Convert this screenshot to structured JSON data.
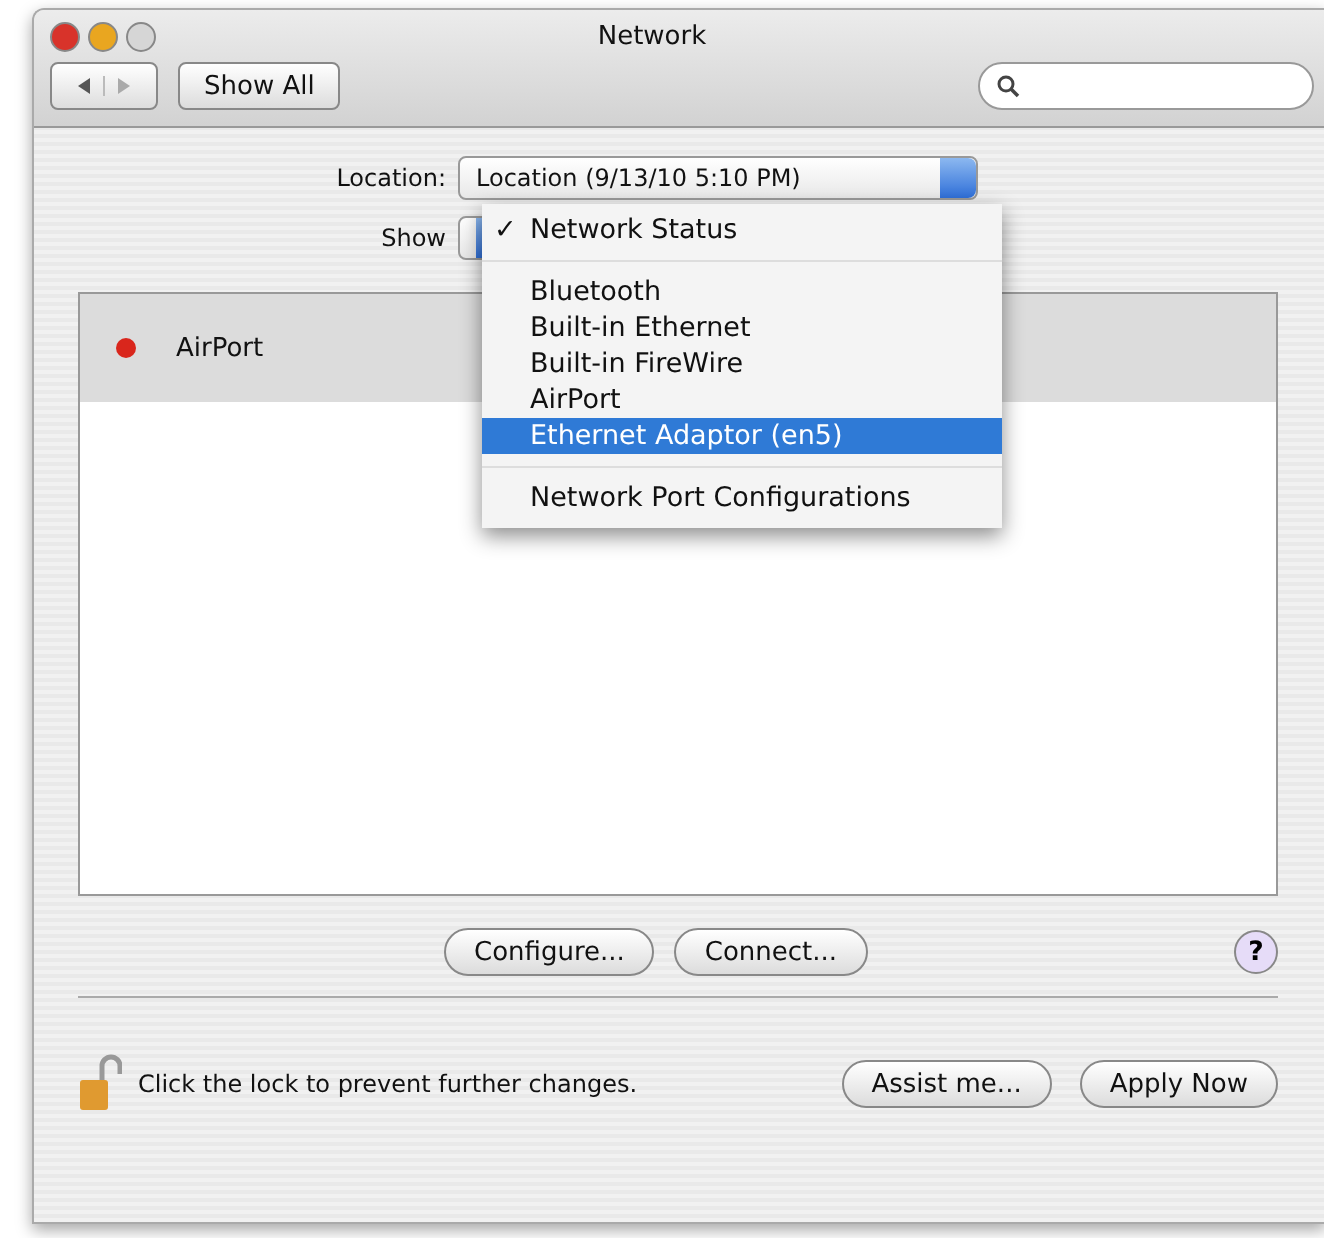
{
  "window": {
    "title": "Network"
  },
  "toolbar": {
    "show_all": "Show All"
  },
  "location": {
    "label": "Location:",
    "value": "Location (9/13/10 5:10 PM)"
  },
  "show": {
    "label": "Show"
  },
  "check_mark": "✓",
  "menu": [
    {
      "kind": "item",
      "label": "Network Status",
      "checked": true,
      "selected": false
    },
    {
      "kind": "separator"
    },
    {
      "kind": "item",
      "label": "Bluetooth",
      "checked": false,
      "selected": false
    },
    {
      "kind": "item",
      "label": "Built-in Ethernet",
      "checked": false,
      "selected": false
    },
    {
      "kind": "item",
      "label": "Built-in FireWire",
      "checked": false,
      "selected": false
    },
    {
      "kind": "item",
      "label": "AirPort",
      "checked": false,
      "selected": false
    },
    {
      "kind": "item",
      "label": "Ethernet Adaptor (en5)",
      "checked": false,
      "selected": true
    },
    {
      "kind": "separator"
    },
    {
      "kind": "item",
      "label": "Network Port Configurations",
      "checked": false,
      "selected": false
    }
  ],
  "services": [
    {
      "name": "AirPort",
      "color": "#d9261c",
      "selected": true
    }
  ],
  "buttons": [
    "Configure...",
    "Connect..."
  ],
  "help": "?",
  "lock_text": "Click the lock to prevent further changes.",
  "footer_buttons": [
    "Assist me...",
    "Apply Now"
  ]
}
